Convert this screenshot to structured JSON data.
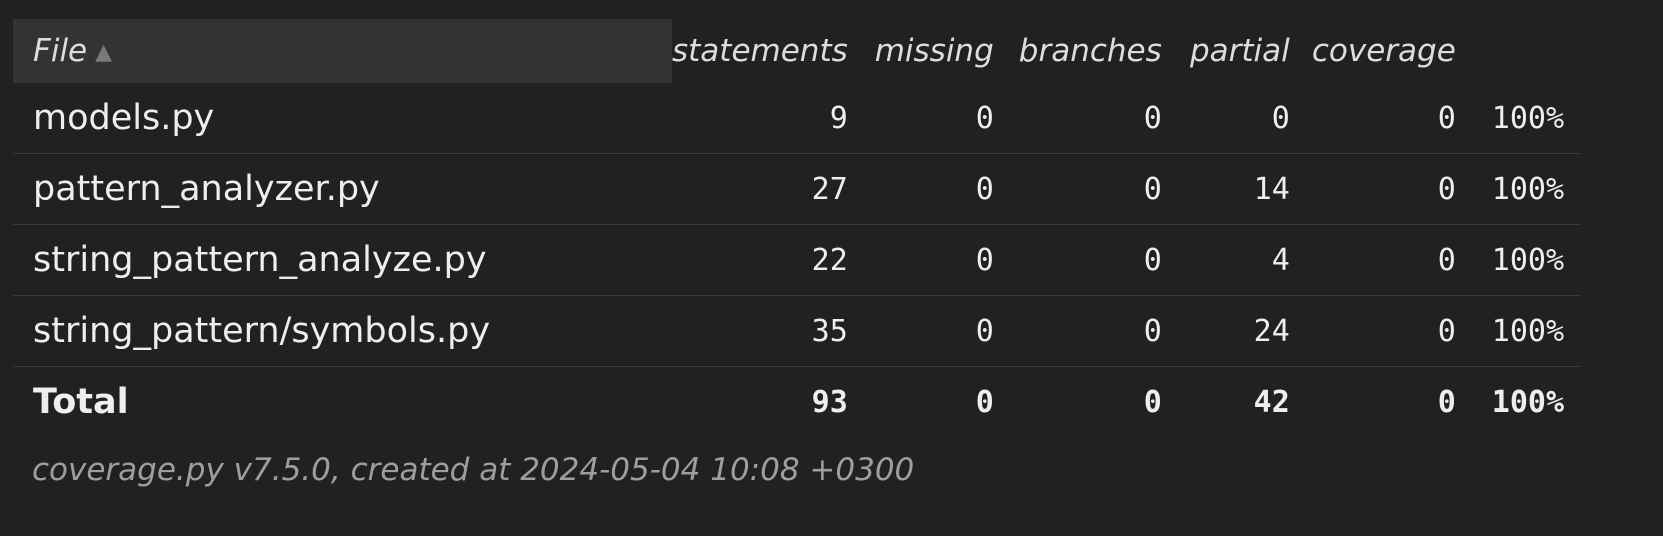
{
  "table": {
    "headers": {
      "file": "File",
      "sort_indicator": "▲",
      "statements": "statements",
      "missing": "missing",
      "branches": "branches",
      "partial": "partial",
      "coverage": "coverage"
    },
    "rows": [
      {
        "file": "models.py",
        "statements": "9",
        "missing": "0",
        "branches": "0",
        "partial": "0",
        "extra": "0",
        "coverage": "100%"
      },
      {
        "file": "pattern_analyzer.py",
        "statements": "27",
        "missing": "0",
        "branches": "0",
        "partial": "14",
        "extra": "0",
        "coverage": "100%"
      },
      {
        "file": "string_pattern_analyze.py",
        "statements": "22",
        "missing": "0",
        "branches": "0",
        "partial": "4",
        "extra": "0",
        "coverage": "100%"
      },
      {
        "file": "string_pattern/symbols.py",
        "statements": "35",
        "missing": "0",
        "branches": "0",
        "partial": "24",
        "extra": "0",
        "coverage": "100%"
      }
    ],
    "total": {
      "file": "Total",
      "statements": "93",
      "missing": "0",
      "branches": "0",
      "partial": "42",
      "extra": "0",
      "coverage": "100%"
    }
  },
  "footer": {
    "text": "coverage.py v7.5.0, created at 2024-05-04 10:08 +0300"
  },
  "colors": {
    "background": "#212121",
    "header_file_bg": "#333333",
    "text": "#eeeeee",
    "footer_text": "#9e9e9e",
    "row_border": "#3b3b3b"
  }
}
